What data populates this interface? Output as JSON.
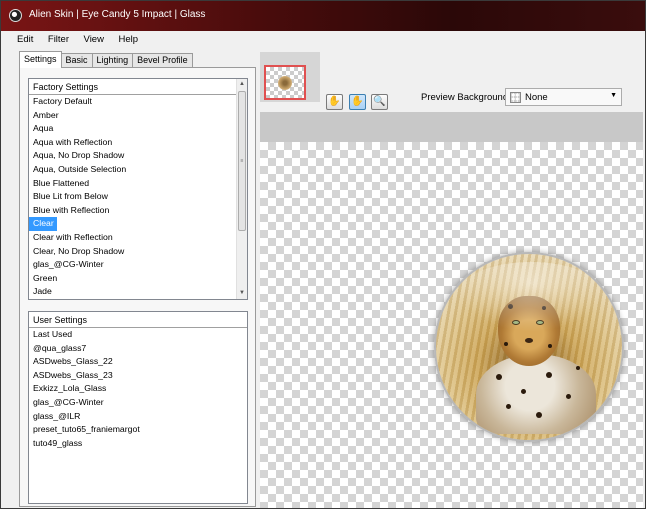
{
  "window": {
    "title": "Alien Skin | Eye Candy 5 Impact | Glass",
    "title_bar_colors": [
      "#7a1515",
      "#2b0808"
    ]
  },
  "menu": [
    "Edit",
    "Filter",
    "View",
    "Help"
  ],
  "tabs": [
    "Settings",
    "Basic",
    "Lighting",
    "Bevel Profile"
  ],
  "active_tab": "Settings",
  "factory_settings": {
    "header": "Factory Settings",
    "items": [
      "Factory Default",
      "Amber",
      "Aqua",
      "Aqua with Reflection",
      "Aqua, No Drop Shadow",
      "Aqua, Outside Selection",
      "Blue Flattened",
      "Blue Lit from Below",
      "Blue with Reflection",
      "Clear",
      "Clear with Reflection",
      "Clear, No Drop Shadow",
      "glas_@CG-Winter",
      "Green",
      "Jade"
    ],
    "selected": "Clear"
  },
  "user_settings": {
    "header": "User Settings",
    "items": [
      "Last Used",
      "@qua_glass7",
      "ASDwebs_Glass_22",
      "ASDwebs_Glass_23",
      "Exkizz_Lola_Glass",
      "glas_@CG-Winter",
      "glass_@ILR",
      "preset_tuto65_franiemargot",
      "tuto49_glass"
    ]
  },
  "toolbar": {
    "icons": [
      "zoom-hand-icon",
      "hand-pan-icon",
      "magnifier-icon"
    ],
    "active": "hand-pan-icon"
  },
  "preview_background": {
    "label": "Preview Background:",
    "value": "None"
  },
  "colors": {
    "selection": "#3399ff",
    "thumbnail_border": "#e05050"
  }
}
